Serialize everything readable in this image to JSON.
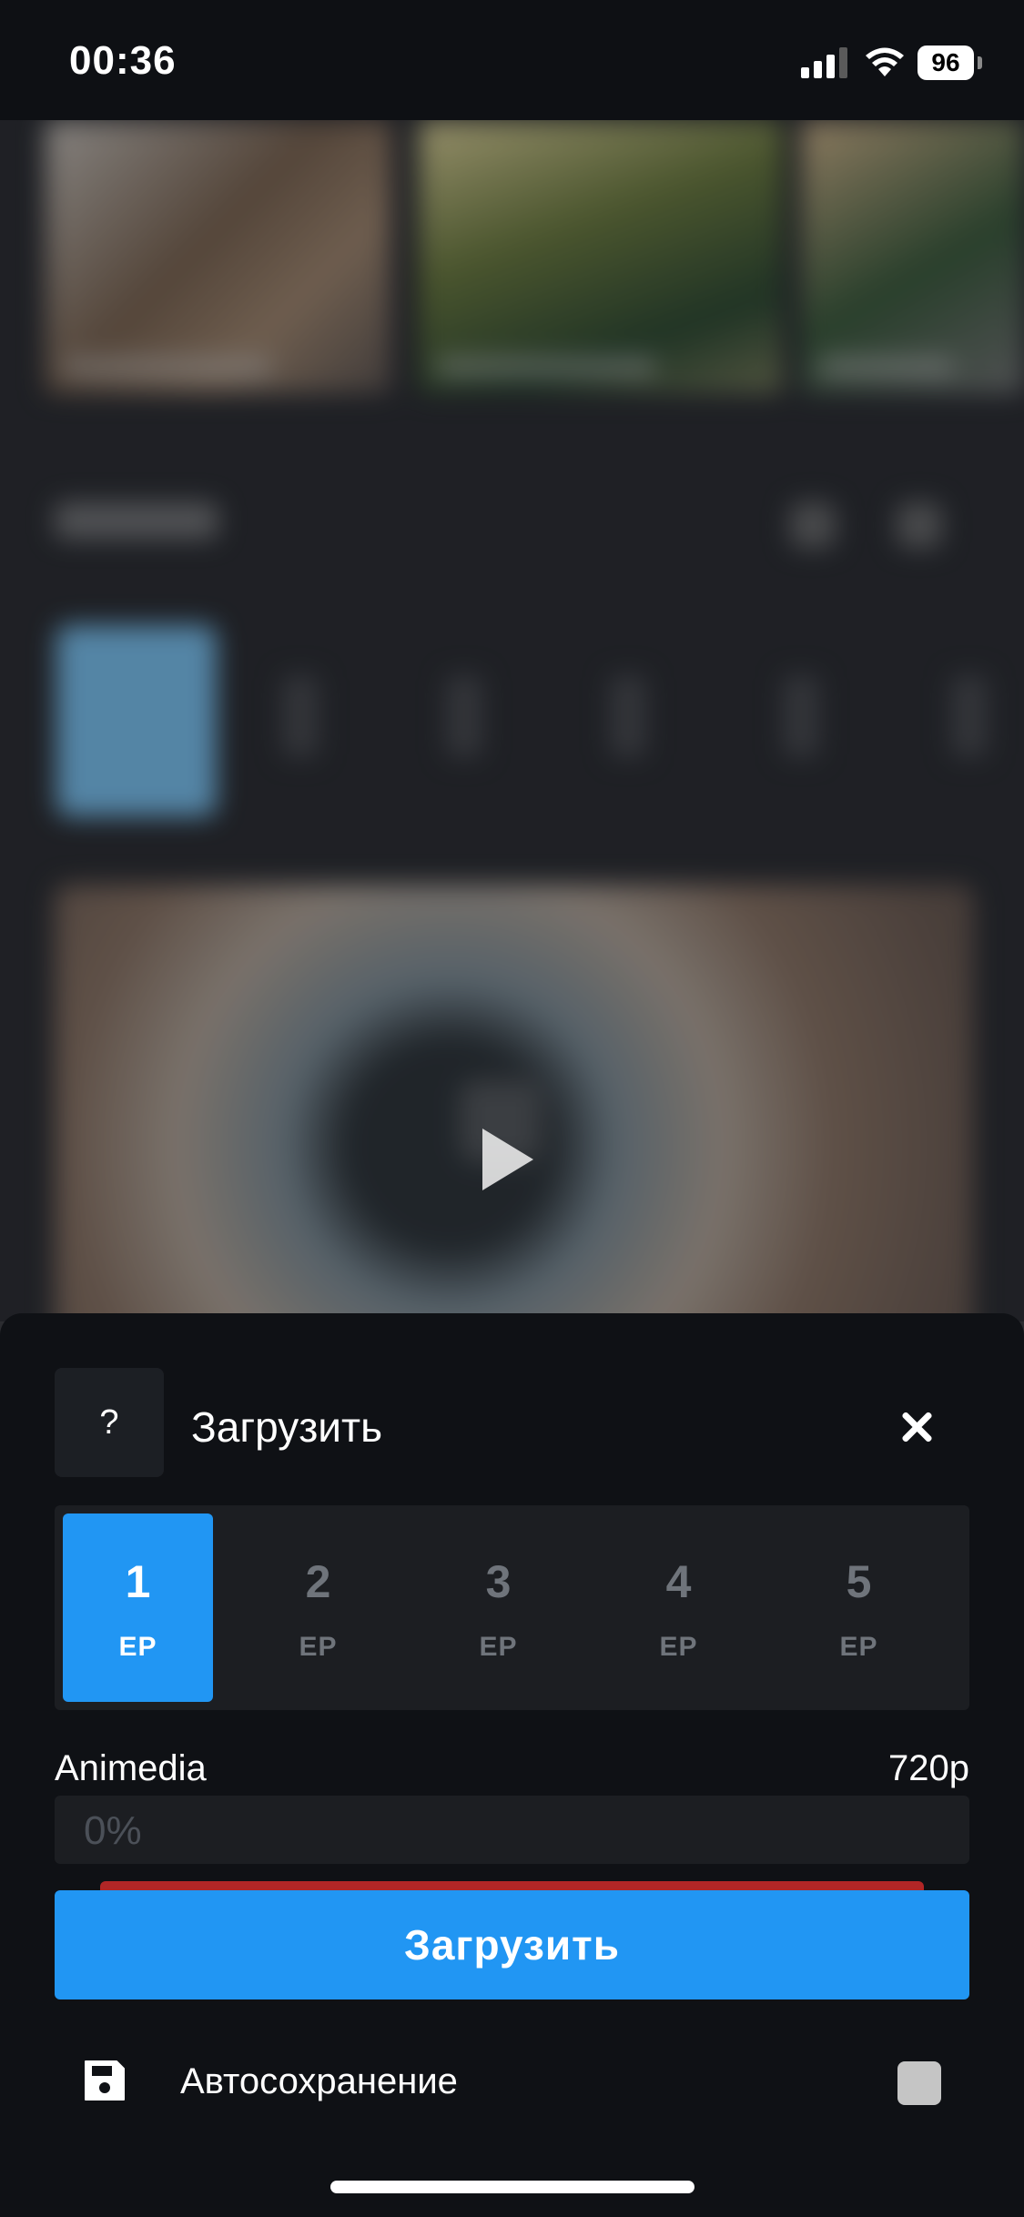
{
  "status_bar": {
    "time": "00:36",
    "battery": "96"
  },
  "sheet": {
    "help_label": "?",
    "title": "Загрузить",
    "episodes": [
      {
        "number": "1",
        "label": "EP"
      },
      {
        "number": "2",
        "label": "EP"
      },
      {
        "number": "3",
        "label": "EP"
      },
      {
        "number": "4",
        "label": "EP"
      },
      {
        "number": "5",
        "label": "EP"
      }
    ],
    "source": "Animedia",
    "quality": "720p",
    "progress_text": "0%",
    "progress_value": 0,
    "download_label": "Загрузить",
    "autosave_label": "Автосохранение",
    "autosave_checked": false
  },
  "colors": {
    "accent": "#2196f3",
    "sheet_bg": "#0f1115",
    "red_strip": "#b12626"
  },
  "icons": {
    "help": "question-icon",
    "close": "close-icon",
    "save": "floppy-disk-icon"
  }
}
